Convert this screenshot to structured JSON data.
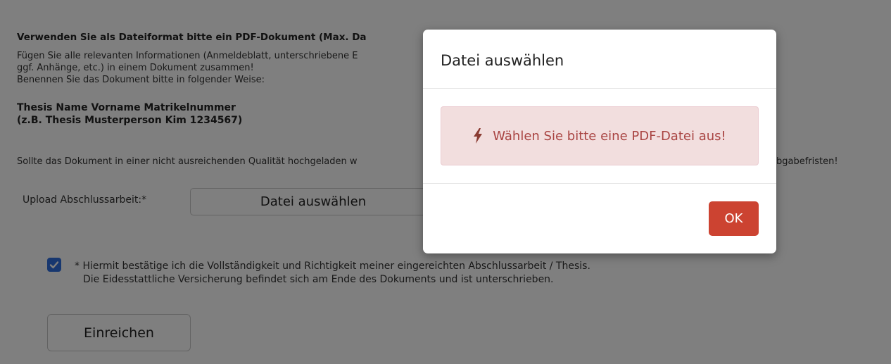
{
  "page": {
    "heading": "Verwenden Sie als Dateiformat bitte ein PDF-Dokument (Max. Da",
    "instructions": [
      "Fügen Sie alle relevanten Informationen (Anmeldeblatt, unterschriebene E",
      "ggf. Anhänge, etc.) in einem Dokument zusammen!",
      "Benennen Sie das Dokument bitte in folgender Weise:"
    ],
    "naming_scheme": [
      "Thesis Name Vorname Matrikelnummer",
      "(z.B. Thesis Musterperson Kim 1234567)"
    ],
    "quality_note_left": "Sollte das Dokument in einer nicht ausreichenden Qualität hochgeladen w",
    "quality_note_right": "bgabefristen!",
    "upload_label": "Upload Abschlussarbeit:*",
    "file_button_label": "Datei auswählen",
    "confirm_checked": true,
    "confirm_lines": [
      "* Hiermit bestätige ich die Vollständigkeit und Richtigkeit meiner eingereichten Abschlussarbeit / Thesis.",
      "Die Eidesstattliche Versicherung befindet sich am Ende des Dokuments und ist unterschrieben."
    ],
    "submit_label": "Einreichen"
  },
  "modal": {
    "title": "Datei auswählen",
    "alert_icon": "bolt-icon",
    "alert_text": "Wählen Sie bitte eine PDF-Datei aus!",
    "ok_label": "OK"
  },
  "colors": {
    "checkbox": "#2f6fde",
    "alert_background": "#f2dede",
    "alert_text": "#a94442",
    "ok_button": "#cc4331",
    "overlay": "#808080"
  }
}
